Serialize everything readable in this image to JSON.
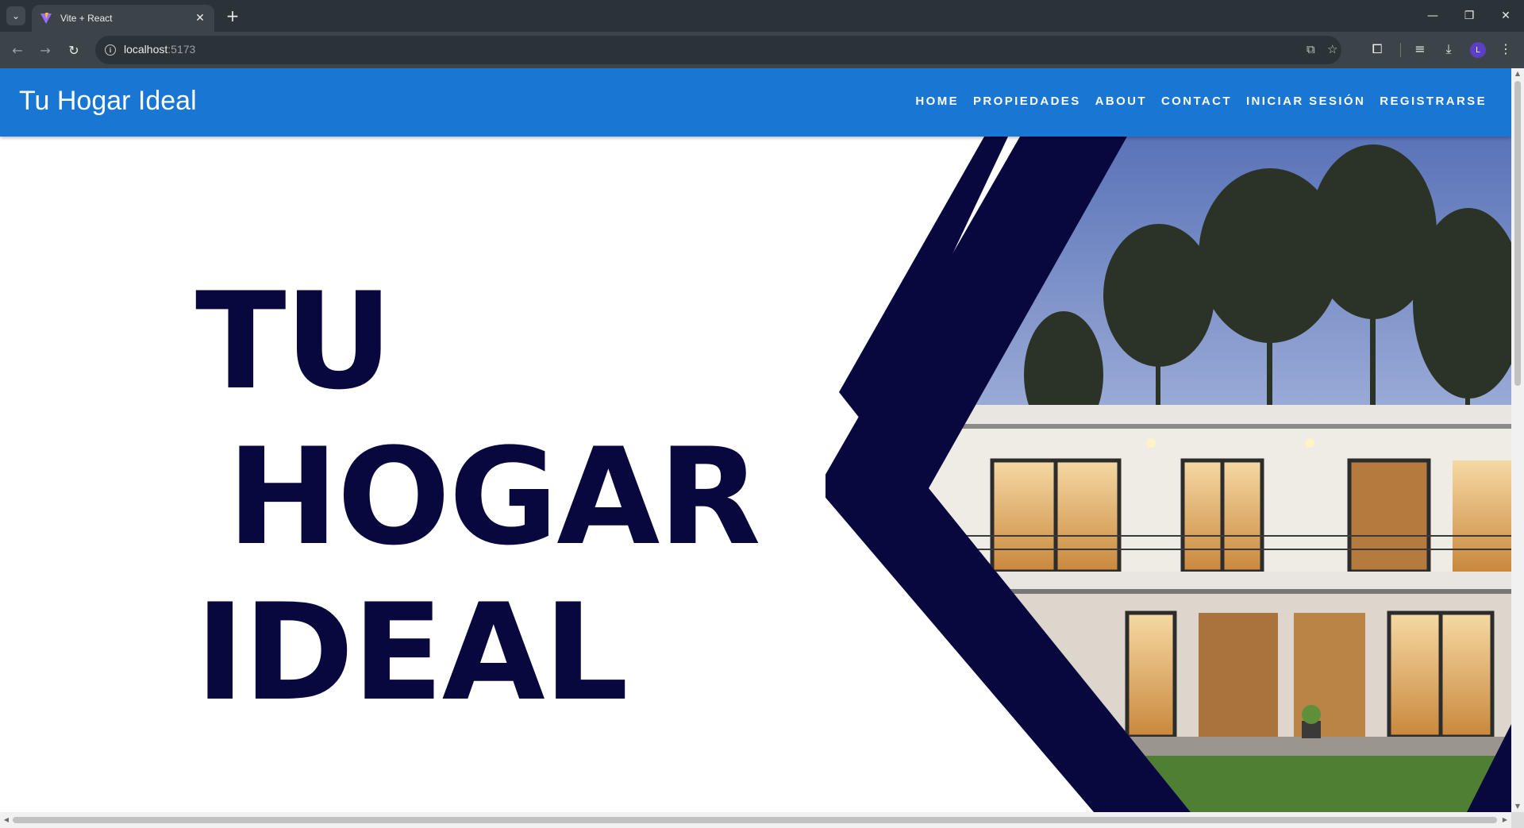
{
  "browser": {
    "tab_title": "Vite + React",
    "url_host": "localhost",
    "url_port": ":5173",
    "profile_initial": "L"
  },
  "site": {
    "brand": "Tu Hogar Ideal",
    "nav": [
      "HOME",
      "PROPIEDADES",
      "ABOUT",
      "CONTACT",
      "INICIAR SESIÓN",
      "REGISTRARSE"
    ],
    "nav_color": "#1976d2"
  },
  "hero": {
    "line1": "TU",
    "line2": "HOGAR",
    "line3": "IDEAL",
    "text_color": "#08083f"
  }
}
